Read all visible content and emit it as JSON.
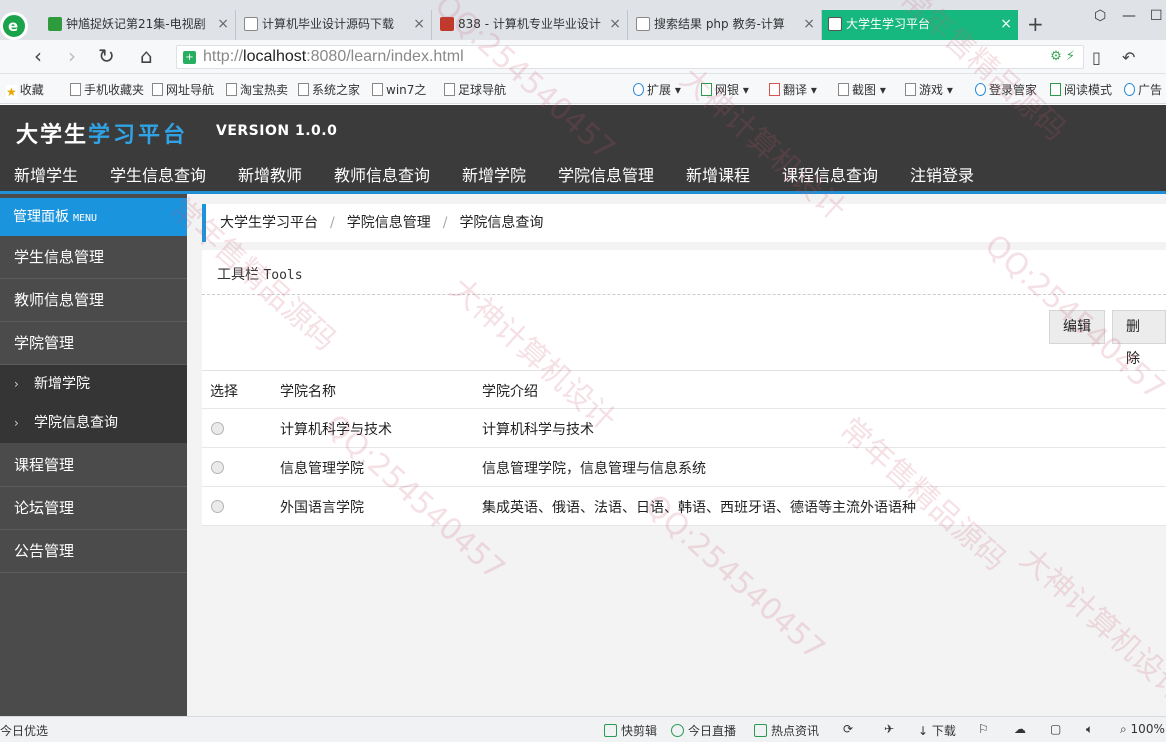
{
  "browser": {
    "logo_letter": "e",
    "tabs": [
      {
        "label": "钟馗捉妖记第21集-电视剧",
        "icon_color": "#2e9b3c"
      },
      {
        "label": "计算机毕业设计源码下载",
        "icon_color": "#ffffff"
      },
      {
        "label": "838 - 计算机专业毕业设计",
        "icon_color": "#c0392b"
      },
      {
        "label": "搜索结果 php 教务-计算",
        "icon_color": "#ffffff"
      },
      {
        "label": "大学生学习平台",
        "icon_color": "#ffffff"
      }
    ],
    "tab_close": "×",
    "new_tab": "+",
    "url_prefix": "http://",
    "url_host": "localhost",
    "url_rest": ":8080/learn/index.html",
    "bookmarks": [
      "收藏",
      "手机收藏夹",
      "网址导航",
      "淘宝热卖",
      "系统之家",
      "win7之",
      "足球导航"
    ],
    "toolbar_right": [
      "扩展",
      "网银",
      "翻译",
      "截图",
      "游戏",
      "登录管家",
      "阅读模式",
      "广告"
    ],
    "status_left": "今日优选",
    "status_right": [
      "快剪辑",
      "今日直播",
      "热点资讯",
      "下载"
    ],
    "zoom": "100%"
  },
  "app": {
    "logo_part1": "大学生",
    "logo_part2": "学习平台",
    "version": "VERSION 1.0.0",
    "topnav": [
      "新增学生",
      "学生信息查询",
      "新增教师",
      "教师信息查询",
      "新增学院",
      "学院信息管理",
      "新增课程",
      "课程信息查询",
      "注销登录"
    ]
  },
  "sidebar": {
    "header": "管理面板",
    "header_en": "MENU",
    "items": [
      "学生信息管理",
      "教师信息管理",
      "学院管理"
    ],
    "subitems": [
      "新增学院",
      "学院信息查询"
    ],
    "items_after": [
      "课程管理",
      "论坛管理",
      "公告管理"
    ]
  },
  "breadcrumb": [
    "大学生学习平台",
    "学院信息管理",
    "学院信息查询"
  ],
  "toolbox": {
    "title": "工具栏",
    "title_en": "Tools",
    "edit_label": "编辑",
    "delete_label": "删除"
  },
  "table": {
    "headers": [
      "选择",
      "学院名称",
      "学院介绍"
    ],
    "rows": [
      {
        "name": "计算机科学与技术",
        "intro": "计算机科学与技术"
      },
      {
        "name": "信息管理学院",
        "intro": "信息管理学院，信息管理与信息系统"
      },
      {
        "name": "外国语言学院",
        "intro": "集成英语、俄语、法语、日语、韩语、西班牙语、德语等主流外语语种"
      }
    ]
  },
  "watermark": {
    "texts": [
      "QQ:254540457",
      "大神计算机设计",
      "常年售精品源码"
    ]
  },
  "colors": {
    "accent": "#1b94de",
    "header_bg": "#3b3b3b",
    "sidebar_bg": "#4b4b4b",
    "active_tab": "#17b87f"
  }
}
